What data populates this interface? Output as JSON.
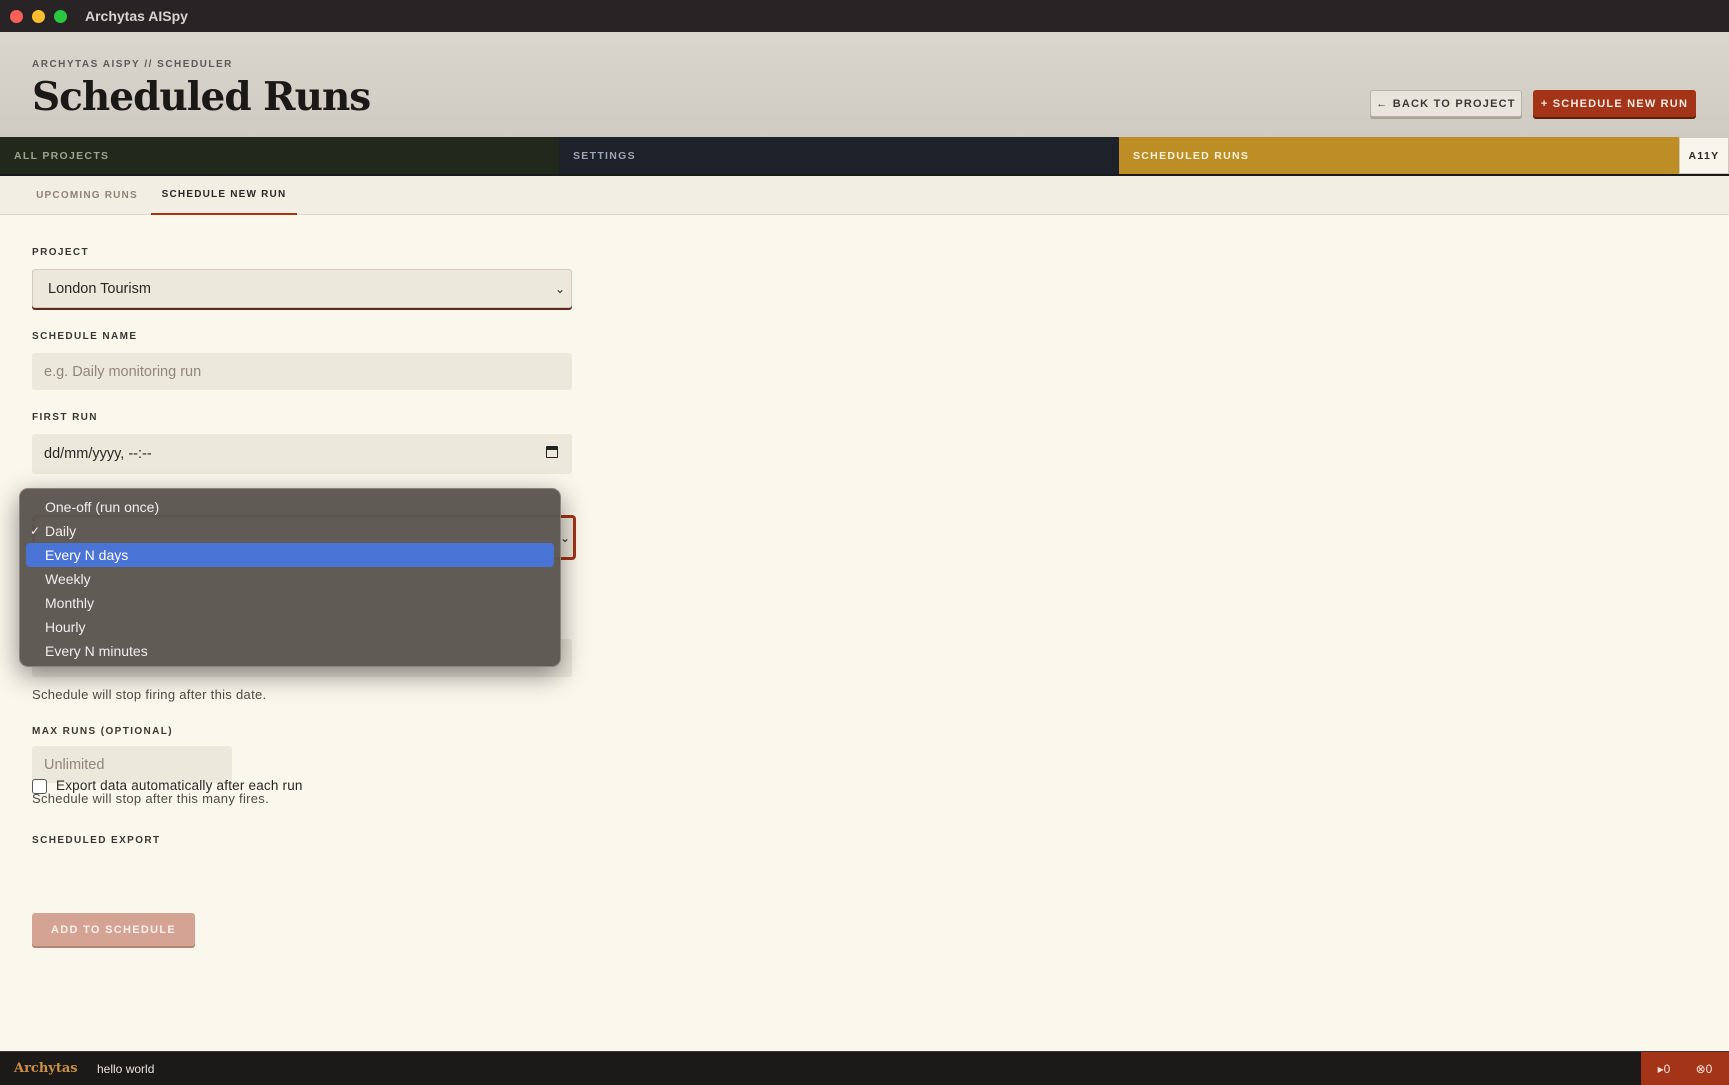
{
  "window": {
    "title": "Archytas AISpy"
  },
  "header": {
    "breadcrumb": "ARCHYTAS AISPY // SCHEDULER",
    "title": "Scheduled Runs",
    "back_button": "← BACK TO PROJECT",
    "new_button": "+ SCHEDULE NEW RUN"
  },
  "nav": {
    "all_projects": "ALL PROJECTS",
    "settings": "SETTINGS",
    "scheduled_runs": "SCHEDULED RUNS",
    "a11y": "A11Y"
  },
  "subtabs": {
    "upcoming": "UPCOMING RUNS",
    "schedule_new": "SCHEDULE NEW RUN"
  },
  "form": {
    "project_label": "PROJECT",
    "project_value": "London Tourism",
    "schedule_name_label": "SCHEDULE NAME",
    "schedule_name_placeholder": "e.g. Daily monitoring run",
    "first_run_label": "FIRST RUN",
    "first_run_placeholder": "dd/mm/yyyy, --:--",
    "end_help": "Schedule will stop firing after this date.",
    "max_runs_label": "MAX RUNS (OPTIONAL)",
    "max_runs_placeholder": "Unlimited",
    "max_runs_help": "Schedule will stop after this many fires.",
    "export_label": "SCHEDULED EXPORT",
    "export_checkbox_label": "Export data automatically after each run",
    "submit_button": "ADD TO SCHEDULE"
  },
  "frequency_dropdown": {
    "checkmark": "✓",
    "options": [
      "One-off (run once)",
      "Daily",
      "Every N days",
      "Weekly",
      "Monthly",
      "Hourly",
      "Every N minutes"
    ],
    "selected": "Daily",
    "highlighted": "Every N days"
  },
  "statusbar": {
    "brand": "Archytas",
    "message": "hello world",
    "runs_count": "▸0",
    "errors_count": "⊗0"
  },
  "colors": {
    "accent": "#a33417",
    "gold": "#bc8e25",
    "highlight": "#4a73d6"
  }
}
